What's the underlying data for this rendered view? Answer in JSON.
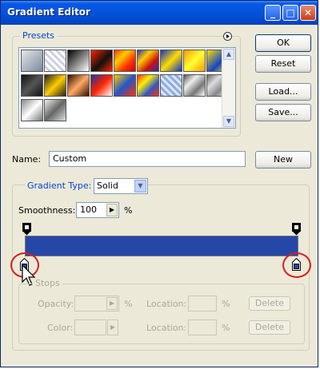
{
  "window": {
    "title": "Gradient Editor",
    "minimize_glyph": "_",
    "maximize_glyph": "□",
    "close_glyph": "✕"
  },
  "presets": {
    "label": "Presets",
    "menu_icon": "circle-arrow-icon"
  },
  "buttons": {
    "ok": "OK",
    "reset": "Reset",
    "load": "Load...",
    "save": "Save...",
    "new": "New"
  },
  "name_field": {
    "label": "Name:",
    "value": "Custom"
  },
  "gradient_type": {
    "label": "Gradient Type:",
    "value": "Solid"
  },
  "smoothness": {
    "label": "Smoothness:",
    "value": "100",
    "unit": "%"
  },
  "gradient_color": "#2547a8",
  "stops": {
    "label": "Stops",
    "opacity_label": "Opacity:",
    "opacity_unit": "%",
    "location_label_1": "Location:",
    "location_unit_1": "%",
    "delete_1": "Delete",
    "color_label": "Color:",
    "location_label_2": "Location:",
    "location_unit_2": "%",
    "delete_2": "Delete"
  },
  "colors": {
    "highlight_circle": "#d6201b",
    "titlebar": "#0553dc",
    "accent_text": "#0046d5"
  }
}
